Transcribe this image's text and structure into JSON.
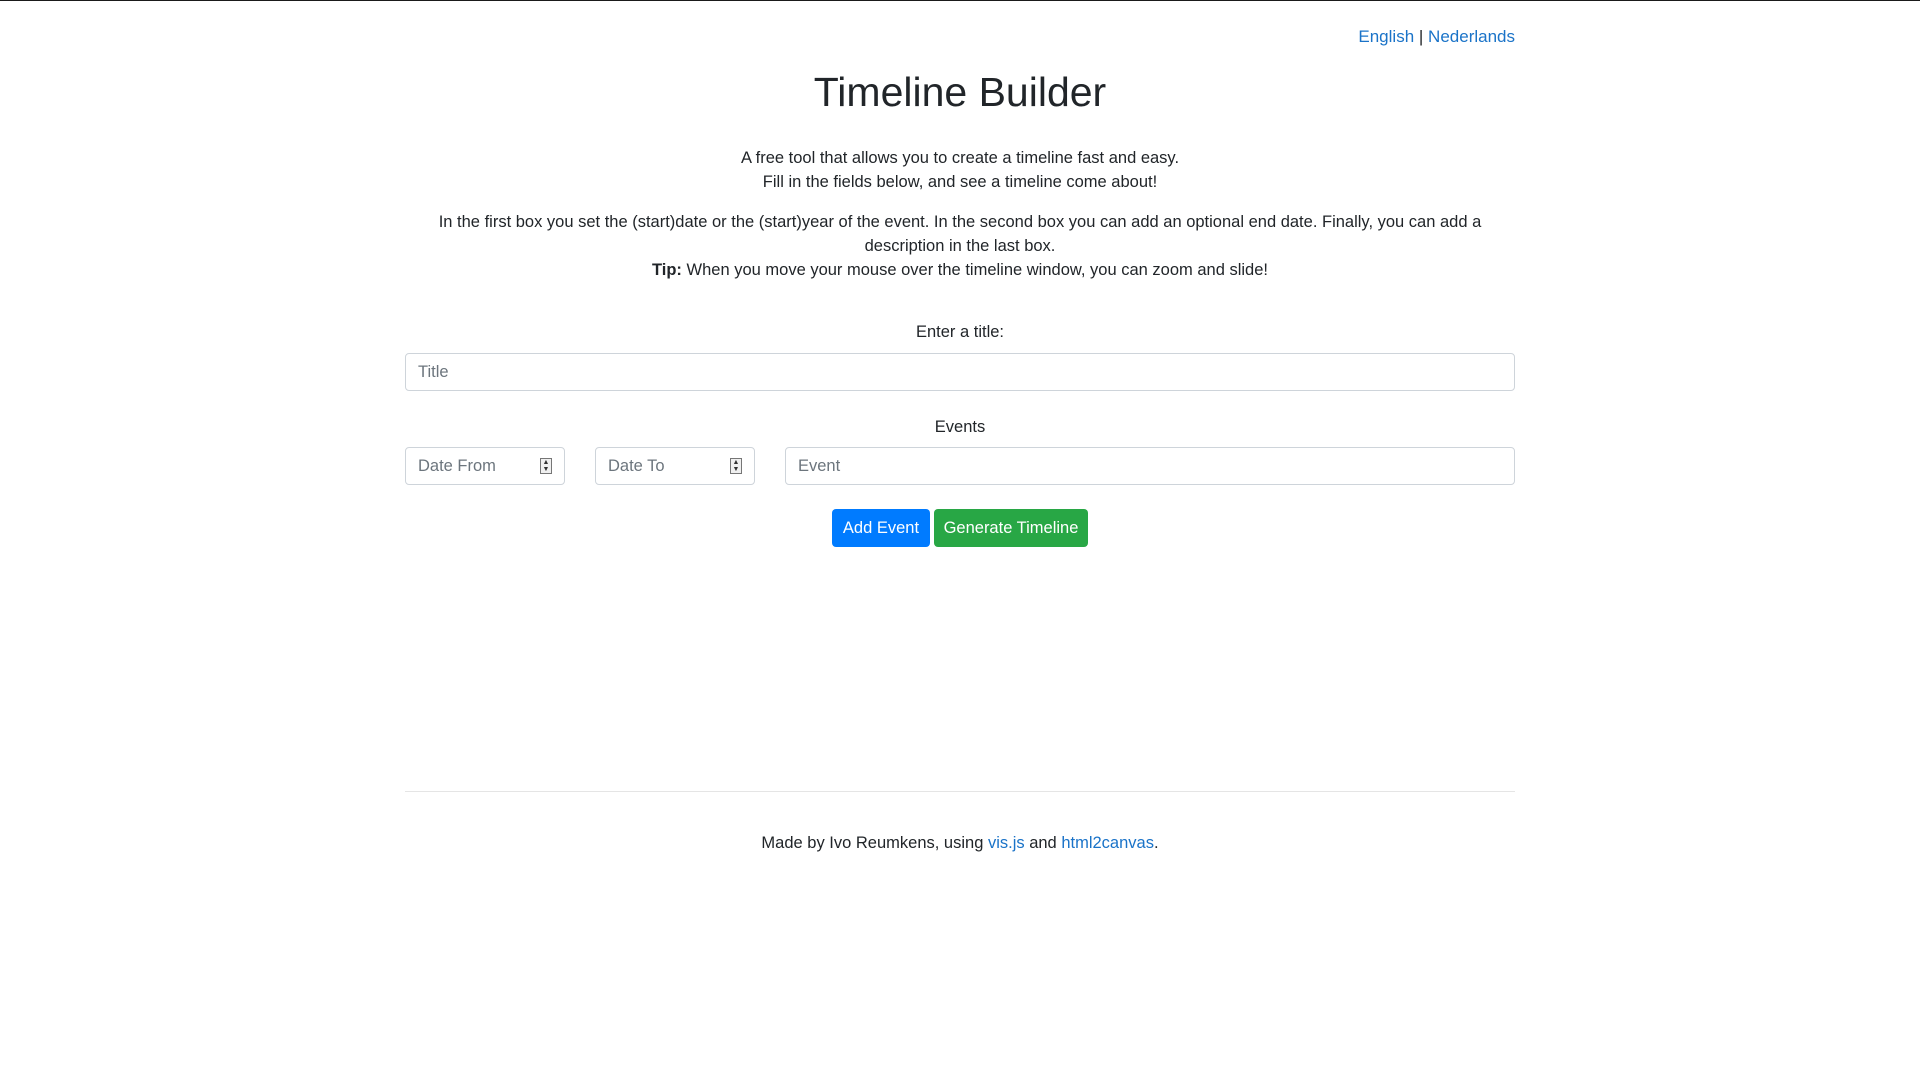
{
  "language_switcher": {
    "english": "English",
    "separator": "|",
    "dutch": "Nederlands"
  },
  "header": {
    "title": "Timeline Builder"
  },
  "intro": {
    "line1": "A free tool that allows you to create a timeline fast and easy.",
    "line2": "Fill in the fields below, and see a timeline come about!"
  },
  "explanation": {
    "text": "In the first box you set the (start)date or the (start)year of the event. In the second box you can add an optional end date. Finally, you can add a description in the last box.",
    "tip_label": "Tip:",
    "tip_text": " When you move your mouse over the timeline window, you can zoom and slide!"
  },
  "form": {
    "title_label": "Enter a title:",
    "title_placeholder": "Title",
    "events_label": "Events",
    "date_from_placeholder": "Date From",
    "date_to_placeholder": "Date To",
    "event_placeholder": "Event",
    "add_event_label": "Add Event",
    "generate_label": "Generate Timeline"
  },
  "footer": {
    "prefix": "Made by Ivo Reumkens, using ",
    "link1": "vis.js",
    "middle": " and ",
    "link2": "html2canvas",
    "suffix": "."
  },
  "colors": {
    "link": "#1a73c8",
    "add_button": "#007bff",
    "generate_button": "#28a745"
  }
}
